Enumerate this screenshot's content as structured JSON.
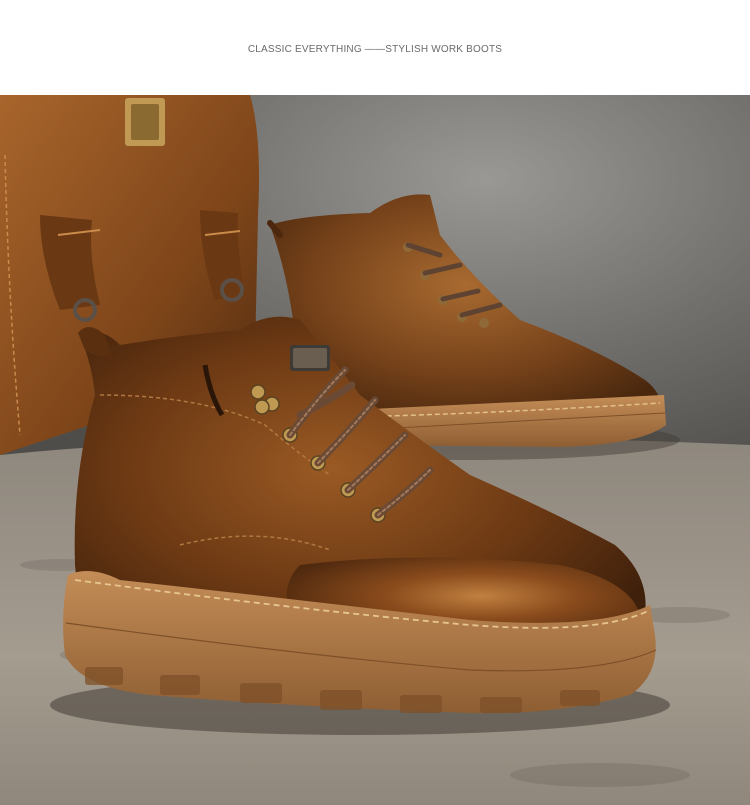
{
  "banner": {
    "tagline": "CLASSIC EVERYTHING ——STYLISH WORK BOOTS"
  },
  "photo": {
    "subject": "brown-leather-work-boots-pair",
    "colors": {
      "backdrop": "#7d7b77",
      "floor": "#9c9489",
      "leather": "#7a4318",
      "leather_highlight": "#b0702e",
      "sole": "#b07a46",
      "laces": "#6a4a35",
      "eyelets": "#b8944a",
      "bag": "#8a4f22"
    }
  }
}
